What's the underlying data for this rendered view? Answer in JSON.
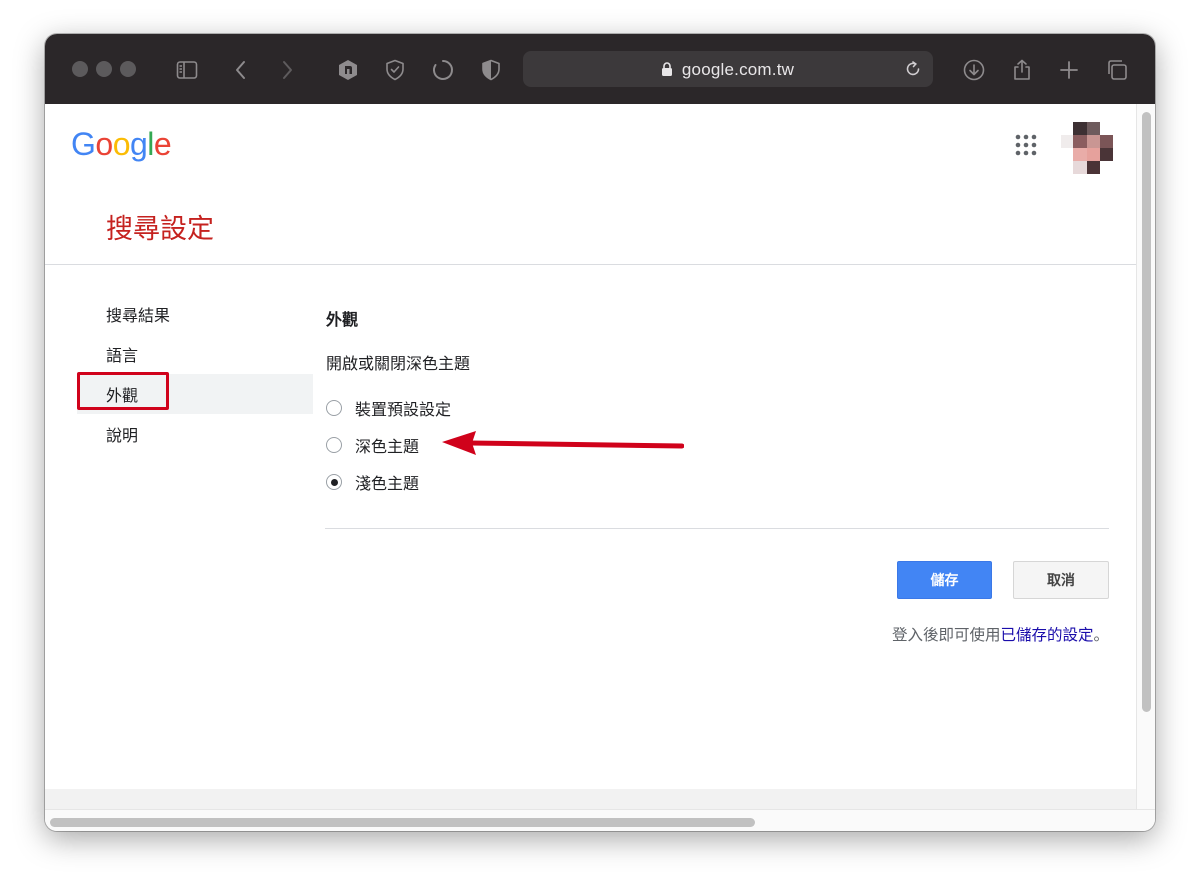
{
  "browser": {
    "url": "google.com.tw"
  },
  "header": {
    "logo_letters": [
      {
        "char": "G",
        "color": "#4285f4"
      },
      {
        "char": "o",
        "color": "#ea4335"
      },
      {
        "char": "o",
        "color": "#fbbc05"
      },
      {
        "char": "g",
        "color": "#4285f4"
      },
      {
        "char": "l",
        "color": "#34a853"
      },
      {
        "char": "e",
        "color": "#ea4335"
      }
    ]
  },
  "page": {
    "title": "搜尋設定"
  },
  "nav": {
    "items": [
      {
        "label": "搜尋結果"
      },
      {
        "label": "語言"
      },
      {
        "label": "外觀"
      },
      {
        "label": "說明"
      }
    ],
    "active_index": 2
  },
  "appearance": {
    "section_title": "外觀",
    "subtitle": "開啟或關閉深色主題",
    "options": [
      {
        "label": "裝置預設設定",
        "checked": false
      },
      {
        "label": "深色主題",
        "checked": false
      },
      {
        "label": "淺色主題",
        "checked": true
      }
    ]
  },
  "actions": {
    "save_label": "儲存",
    "cancel_label": "取消"
  },
  "signin_note": {
    "prefix": "登入後即可使用",
    "link": "已儲存的設定",
    "suffix": "。"
  },
  "colors": {
    "title_red": "#c5221f",
    "save_blue": "#4285f4",
    "annotation_red": "#d0021b",
    "link_blue": "#1a0dab",
    "toolbar_dark": "#2b2729"
  }
}
